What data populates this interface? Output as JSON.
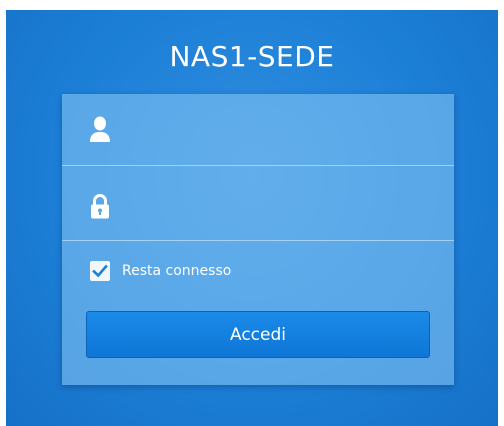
{
  "server_name": "NAS1-SEDE",
  "username": {
    "icon": "user-icon",
    "value": "",
    "placeholder": ""
  },
  "password": {
    "icon": "lock-icon",
    "value": "",
    "placeholder": ""
  },
  "remember_me": {
    "label": "Resta connesso",
    "checked": true
  },
  "login_button": {
    "label": "Accedi"
  },
  "colors": {
    "background": "#1c7fd6",
    "panel": "#5eaae8",
    "button": "#1482e0",
    "text": "#ffffff"
  }
}
